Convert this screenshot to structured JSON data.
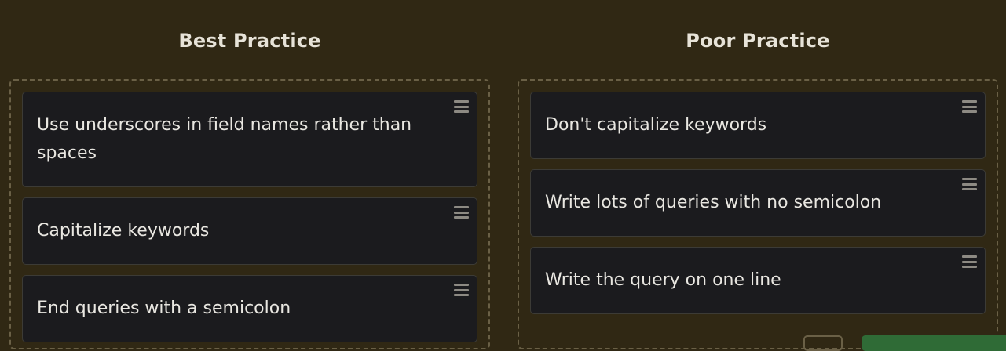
{
  "columns": {
    "best": {
      "title": "Best Practice",
      "cards": [
        {
          "text": "Use underscores in field names rather than spaces",
          "handle_icon": "drag-handle-icon"
        },
        {
          "text": "Capitalize keywords",
          "handle_icon": "drag-handle-icon"
        },
        {
          "text": "End queries with a semicolon",
          "handle_icon": "drag-handle-icon"
        }
      ]
    },
    "poor": {
      "title": "Poor Practice",
      "cards": [
        {
          "text": "Don't capitalize keywords",
          "handle_icon": "drag-handle-icon"
        },
        {
          "text": "Write lots of queries with no semicolon",
          "handle_icon": "drag-handle-icon"
        },
        {
          "text": "Write the query on one line",
          "handle_icon": "drag-handle-icon"
        }
      ]
    }
  },
  "colors": {
    "background": "#302814",
    "card_background": "#1b1b1e",
    "card_text": "#e9e7e1",
    "title_text": "#e7e3d8",
    "dashed_border": "#6a6046",
    "action_button": "#2f6b36"
  }
}
